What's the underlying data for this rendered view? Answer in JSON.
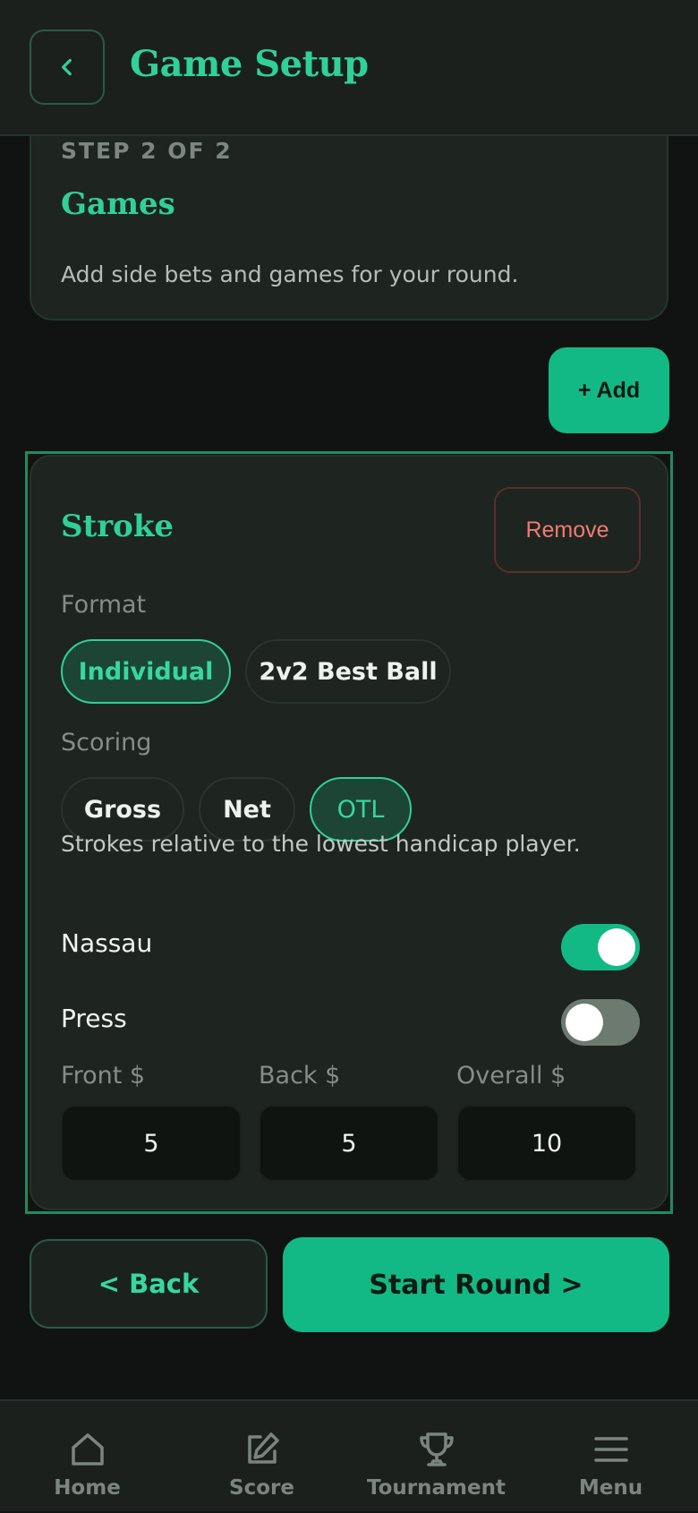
{
  "header": {
    "title": "Game Setup",
    "back_icon": "chevron-left-icon"
  },
  "step": {
    "label": "STEP 2 OF 2",
    "title": "Games",
    "description": "Add side bets and games for your round."
  },
  "add_button": {
    "label": "+ Add"
  },
  "game": {
    "name": "Stroke",
    "remove_label": "Remove",
    "format": {
      "label": "Format",
      "options": [
        "Individual",
        "2v2 Best Ball"
      ],
      "selected": "Individual"
    },
    "scoring": {
      "label": "Scoring",
      "options": [
        "Gross",
        "Net",
        "OTL"
      ],
      "selected": "OTL"
    },
    "helper_text": "Strokes relative to the lowest handicap player.",
    "toggles": [
      {
        "label": "Nassau",
        "on": true
      },
      {
        "label": "Press",
        "on": false
      }
    ],
    "amounts": [
      {
        "label": "Front $",
        "value": "5"
      },
      {
        "label": "Back $",
        "value": "5"
      },
      {
        "label": "Overall $",
        "value": "10"
      }
    ]
  },
  "actions": {
    "back_label": "< Back",
    "start_label": "Start Round >"
  },
  "nav": {
    "items": [
      {
        "label": "Home",
        "icon": "home-icon"
      },
      {
        "label": "Score",
        "icon": "edit-icon"
      },
      {
        "label": "Tournament",
        "icon": "trophy-icon"
      },
      {
        "label": "Menu",
        "icon": "menu-icon"
      }
    ]
  },
  "colors": {
    "accent": "#12b985",
    "accent_text": "#2fd199",
    "background": "#101311",
    "card": "#1e2420",
    "danger": "#f07b73"
  }
}
